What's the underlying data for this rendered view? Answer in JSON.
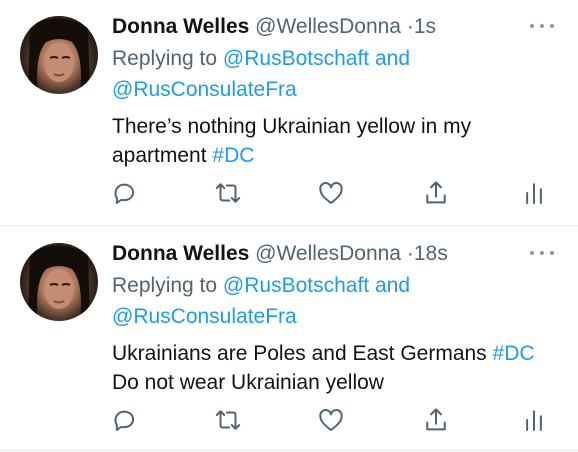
{
  "tweets": [
    {
      "name": "Donna Welles",
      "handle": "@WellesDonna",
      "separator": "·",
      "time": "1s",
      "replying_prefix": "Replying to",
      "reply_to_1": "@RusBotschaft",
      "reply_and": "and",
      "reply_to_2": "@RusConsulateFra",
      "text_line1": "There’s nothing Ukrainian yellow in my",
      "text_line2": "apartment",
      "hashtag": "#DC"
    },
    {
      "name": "Donna Welles",
      "handle": "@WellesDonna",
      "separator": "·",
      "time": "18s",
      "replying_prefix": "Replying to",
      "reply_to_1": "@RusBotschaft",
      "reply_and": "and",
      "reply_to_2": "@RusConsulateFra",
      "text_line1": "Ukrainians are Poles and East Germans",
      "hashtag": "#DC",
      "text_line2": "Do not wear Ukrainian yellow"
    }
  ],
  "icons": [
    "more-icon",
    "reply-icon",
    "retweet-icon",
    "like-icon",
    "share-icon",
    "analytics-icon"
  ],
  "colors": {
    "link": "#1d9bf0",
    "secondary": "#536471",
    "icon": "#536471",
    "divider": "#e6ecf0"
  }
}
